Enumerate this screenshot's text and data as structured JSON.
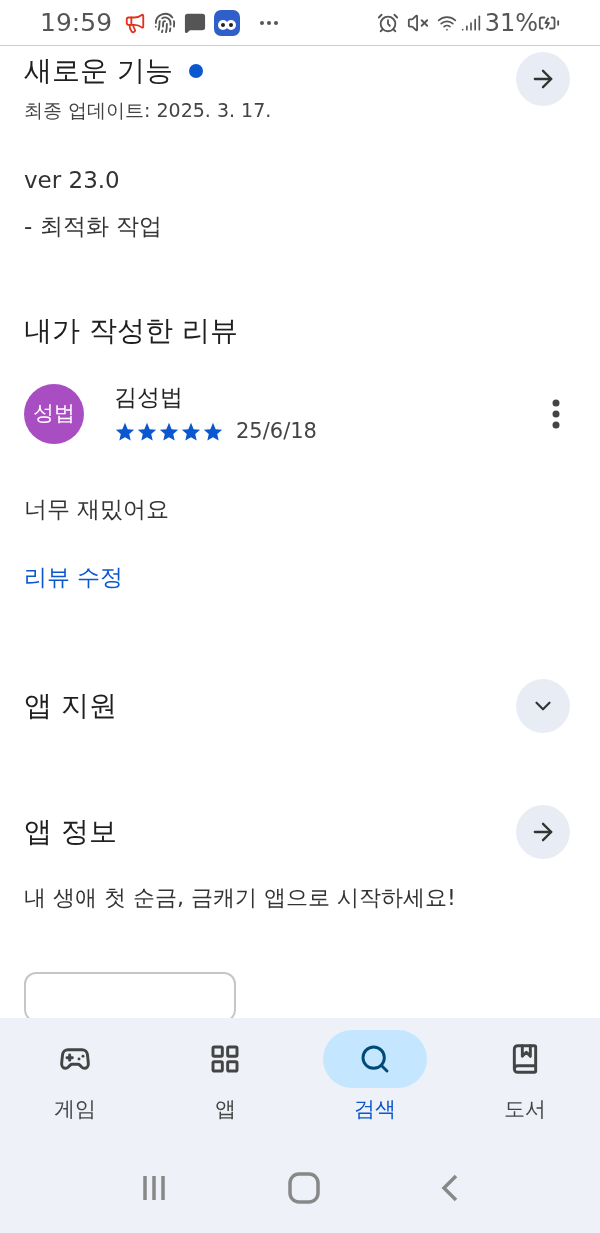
{
  "status_bar": {
    "time": "19:59",
    "battery": "31%"
  },
  "whats_new": {
    "title": "새로운 기능",
    "new": true,
    "updated": "최종 업데이트: 2025. 3. 17.",
    "lines": [
      "ver 23.0",
      "- 최적화 작업"
    ]
  },
  "my_review": {
    "heading": "내가 작성한 리뷰",
    "avatar": "성법",
    "name": "김성법",
    "stars": 5,
    "date": "25/6/18",
    "body": "너무 재밌어요",
    "edit_link": "리뷰 수정"
  },
  "app_support": {
    "title": "앱 지원",
    "expanded": false
  },
  "app_info": {
    "title": "앱 정보",
    "description": "내 생애 첫 순금, 금캐기 앱으로 시작하세요!"
  },
  "bottom_nav": [
    {
      "label": "게임",
      "kind": "games",
      "selected": false
    },
    {
      "label": "앱",
      "kind": "apps",
      "selected": false
    },
    {
      "label": "검색",
      "kind": "search",
      "selected": true
    },
    {
      "label": "도서",
      "kind": "books",
      "selected": false
    }
  ]
}
